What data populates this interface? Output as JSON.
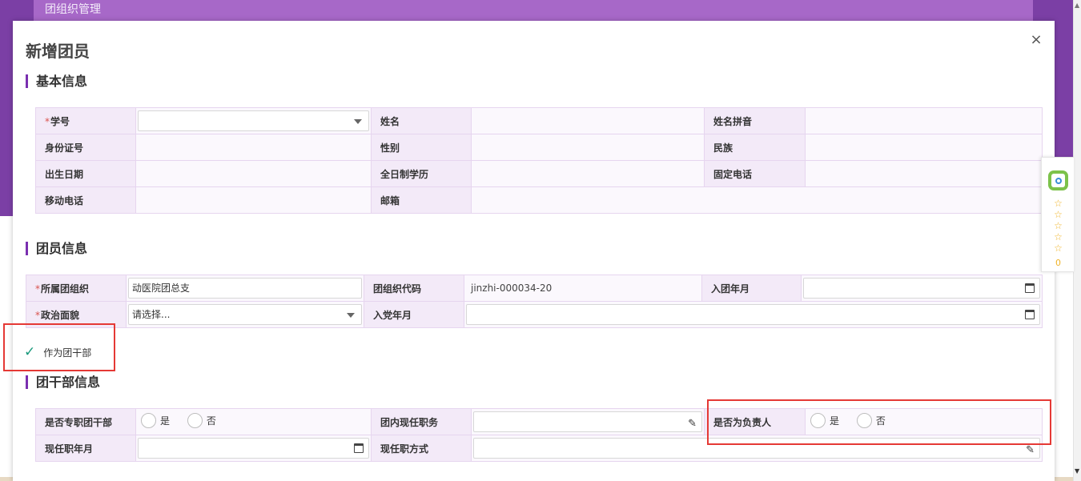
{
  "background": {
    "header_title": "团组织管理"
  },
  "modal": {
    "title": "新增团员",
    "close_label": "×"
  },
  "sections": {
    "basic": "基本信息",
    "member": "团员信息",
    "cadre": "团干部信息"
  },
  "basic_info": {
    "student_id": {
      "label": "学号",
      "value": ""
    },
    "name": {
      "label": "姓名",
      "value": ""
    },
    "name_pinyin": {
      "label": "姓名拼音",
      "value": ""
    },
    "id_card": {
      "label": "身份证号",
      "value": ""
    },
    "gender": {
      "label": "性别",
      "value": ""
    },
    "ethnicity": {
      "label": "民族",
      "value": ""
    },
    "birth_date": {
      "label": "出生日期",
      "value": ""
    },
    "education": {
      "label": "全日制学历",
      "value": ""
    },
    "landline": {
      "label": "固定电话",
      "value": ""
    },
    "mobile": {
      "label": "移动电话",
      "value": ""
    },
    "email": {
      "label": "邮箱",
      "value": ""
    }
  },
  "member_info": {
    "org": {
      "label": "所属团组织",
      "value": "动医院团总支"
    },
    "org_code": {
      "label": "团组织代码",
      "value": "jinzhi-000034-20"
    },
    "join_date": {
      "label": "入团年月",
      "value": ""
    },
    "political_status": {
      "label": "政治面貌",
      "value": "请选择..."
    },
    "party_join_date": {
      "label": "入党年月",
      "value": ""
    }
  },
  "cadre_toggle": {
    "label": "作为团干部",
    "checked": true
  },
  "cadre_info": {
    "full_time": {
      "label": "是否专职团干部",
      "yes": "是",
      "no": "否"
    },
    "current_position": {
      "label": "团内现任职务",
      "value": ""
    },
    "is_leader": {
      "label": "是否为负责人",
      "yes": "是",
      "no": "否"
    },
    "position_date": {
      "label": "现任职年月",
      "value": ""
    },
    "position_method": {
      "label": "现任职方式",
      "value": ""
    }
  },
  "side_widget": {
    "stars": "☆☆☆☆☆",
    "count": "0"
  },
  "colors": {
    "accent": "#7a2fb0",
    "label_bg": "#f3eaf8",
    "highlight": "#e53935",
    "check": "#1a9a7c"
  }
}
